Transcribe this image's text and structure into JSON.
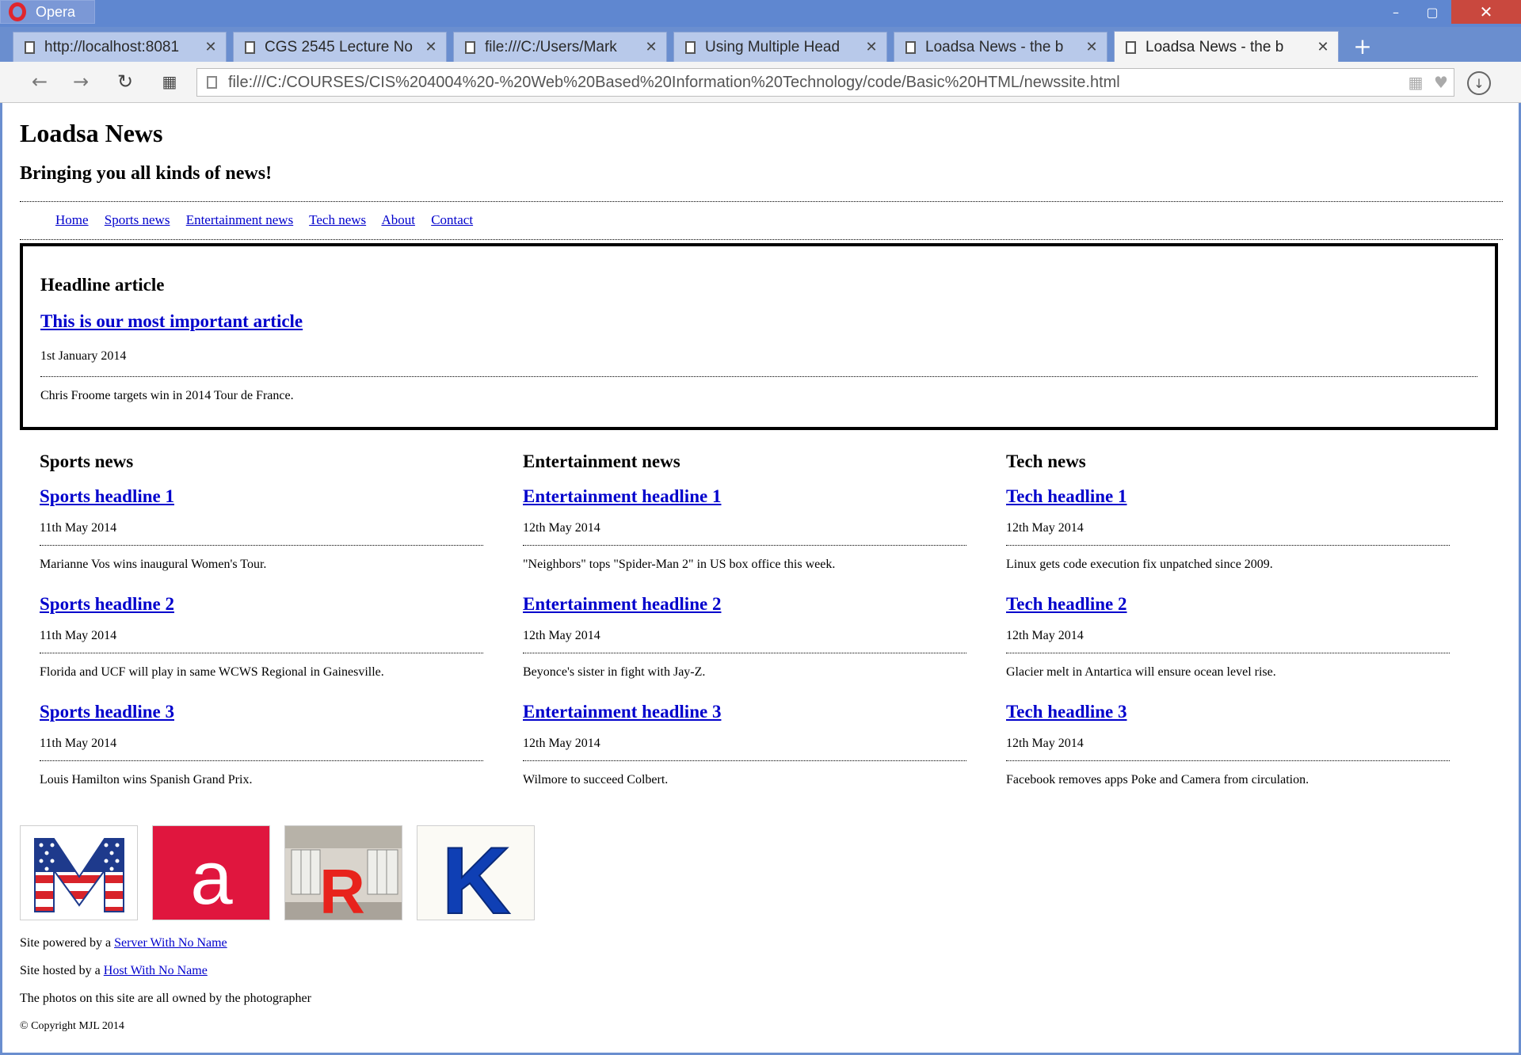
{
  "browser": {
    "app_name": "Opera",
    "tabs": [
      {
        "label": "http://localhost:8081",
        "active": false
      },
      {
        "label": "CGS 2545 Lecture No",
        "active": false
      },
      {
        "label": "file:///C:/Users/Mark",
        "active": false
      },
      {
        "label": "Using Multiple Head",
        "active": false
      },
      {
        "label": "Loadsa News - the b",
        "active": false
      },
      {
        "label": "Loadsa News - the b",
        "active": true
      }
    ],
    "address_url": "file:///C:/COURSES/CIS%204004%20-%20Web%20Based%20Information%20Technology/code/Basic%20HTML/newssite.html"
  },
  "site": {
    "title": "Loadsa News",
    "subtitle": "Bringing you all kinds of news!",
    "nav": [
      "Home",
      "Sports news",
      "Entertainment news",
      "Tech news",
      "About",
      "Contact"
    ],
    "headline": {
      "section_title": "Headline article",
      "link": "This is our most important article",
      "date": "1st January 2014",
      "text": "Chris Froome targets win in 2014 Tour de France."
    },
    "columns": [
      {
        "title": "Sports news",
        "items": [
          {
            "link": "Sports headline 1",
            "date": "11th May 2014",
            "text": "Marianne Vos wins inaugural Women's Tour."
          },
          {
            "link": "Sports headline 2",
            "date": "11th May 2014",
            "text": "Florida and UCF will play in same WCWS Regional in Gainesville."
          },
          {
            "link": "Sports headline 3",
            "date": "11th May 2014",
            "text": "Louis Hamilton wins Spanish Grand Prix."
          }
        ]
      },
      {
        "title": "Entertainment news",
        "items": [
          {
            "link": "Entertainment headline 1",
            "date": "12th May 2014",
            "text": "\"Neighbors\" tops \"Spider-Man 2\" in US box office this week."
          },
          {
            "link": "Entertainment headline 2",
            "date": "12th May 2014",
            "text": "Beyonce's sister in fight with Jay-Z."
          },
          {
            "link": "Entertainment headline 3",
            "date": "12th May 2014",
            "text": "Wilmore to succeed Colbert."
          }
        ]
      },
      {
        "title": "Tech news",
        "items": [
          {
            "link": "Tech headline 1",
            "date": "12th May 2014",
            "text": "Linux gets code execution fix unpatched since 2009."
          },
          {
            "link": "Tech headline 2",
            "date": "12th May 2014",
            "text": "Glacier melt in Antartica will ensure ocean level rise."
          },
          {
            "link": "Tech headline 3",
            "date": "12th May 2014",
            "text": "Facebook removes apps Poke and Camera from circulation."
          }
        ]
      }
    ],
    "logo_letters": [
      "M",
      "a",
      "R",
      "K"
    ],
    "footer": {
      "powered_prefix": "Site powered by a",
      "powered_link": "Server With No Name",
      "hosted_prefix": "Site hosted by a",
      "hosted_link": "Host With No Name",
      "photos_note": "The photos on this site are all owned by the photographer",
      "copyright": "© Copyright MJL 2014"
    }
  },
  "colors": {
    "link": "#0000cc",
    "window_chrome": "#5f87d0",
    "close_button": "#c9483e"
  }
}
